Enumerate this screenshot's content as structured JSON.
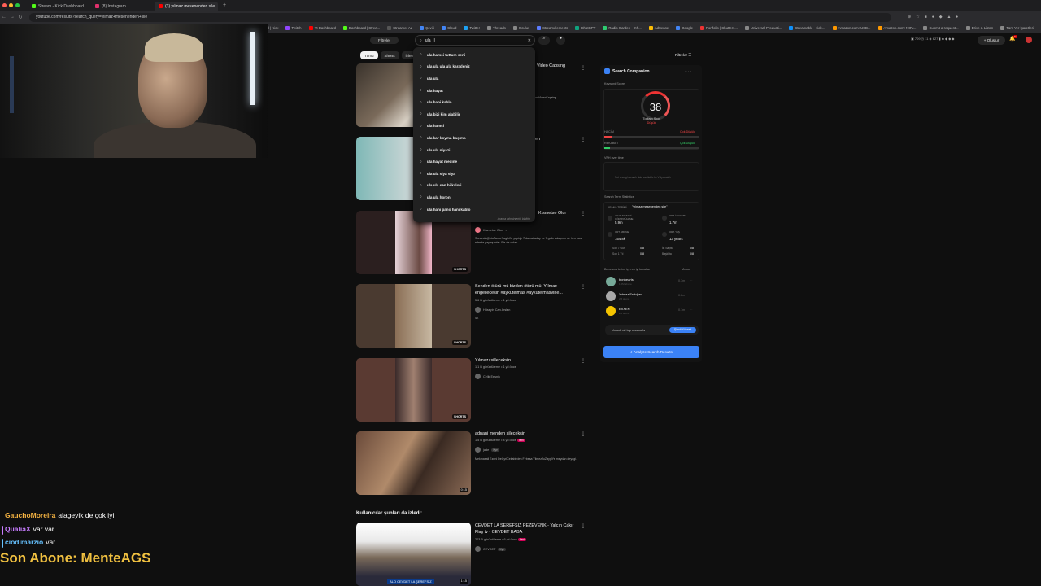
{
  "browser": {
    "tabs": [
      {
        "label": "Stream - Kick Dashboard",
        "color": "#53fc18",
        "active": false
      },
      {
        "label": "(8) Instagram",
        "color": "#e1306c",
        "active": false
      },
      {
        "label": "(3) yılmaz mesenenden sile",
        "color": "#ff0000",
        "active": true
      }
    ],
    "new_tab": "+",
    "url": "youtube.com/results?search_query=yilmaz+mesenenden+sile",
    "bookmarks": [
      {
        "label": "sterer | Kick",
        "color": "#53fc18"
      },
      {
        "label": "Dashboard | Kick",
        "color": "#53fc18"
      },
      {
        "label": "Twitch",
        "color": "#9146ff"
      },
      {
        "label": "Yt Dashboard",
        "color": "#ff0000"
      },
      {
        "label": "Dashboard | Strea...",
        "color": "#53fc18"
      },
      {
        "label": "Streamer Ad",
        "color": "#555"
      },
      {
        "label": "Çeviri",
        "color": "#4285f4"
      },
      {
        "label": "Cloud",
        "color": "#4285f4"
      },
      {
        "label": "Twitter",
        "color": "#1da1f2"
      },
      {
        "label": "Threads",
        "color": "#888"
      },
      {
        "label": "Oculus",
        "color": "#888"
      },
      {
        "label": "Streamelements",
        "color": "#5b7cff"
      },
      {
        "label": "ChatGPT",
        "color": "#10a37f"
      },
      {
        "label": "Radio Garden – Kh...",
        "color": "#2ecc71"
      },
      {
        "label": "AdSense",
        "color": "#fbbc05"
      },
      {
        "label": "Google",
        "color": "#4285f4"
      },
      {
        "label": "Portfolio | Shutters...",
        "color": "#e33"
      },
      {
        "label": "Universal Producti...",
        "color": "#888"
      },
      {
        "label": "Streamable - vide...",
        "color": "#0f90fa"
      },
      {
        "label": "Amazon.com: USB...",
        "color": "#ff9900"
      },
      {
        "label": "Amazon.com: NOV...",
        "color": "#ff9900"
      },
      {
        "label": "Submit a request...",
        "color": "#888"
      },
      {
        "label": "Drive & Listen",
        "color": "#888"
      },
      {
        "label": "Tüm Yer İşaretleri",
        "color": "#888"
      }
    ]
  },
  "youtube": {
    "filters_chip": "Filtreler",
    "search_value": "ula",
    "create_label": "Oluştur",
    "notif_count": "9+",
    "chips": [
      "Tümü",
      "Shorts",
      "İzlenm"
    ],
    "filters_right": "Filtreler",
    "suggestions": [
      "ula hamsi tuttum seni",
      "ula ula ula ula karadeniz",
      "ula ula",
      "ula hayat",
      "ula hani kablo",
      "ula bizi kim alabilir",
      "ula hamsi",
      "ula kar koyma başıma",
      "ula ula niyazi",
      "ula hayat medine",
      "ula ula siya siya",
      "ula ula sen bi kalori",
      "ula ula horon",
      "ula hani pano hani kablo"
    ],
    "report_label": "Arama tahminlerini bildirin",
    "results": [
      {
        "title": "Video Capsing",
        "meta": "",
        "channel": "",
        "desc": "om/VideoCapsing",
        "badge": ""
      },
      {
        "title": "en",
        "meta": "",
        "channel": "",
        "desc": "",
        "badge": ""
      },
      {
        "title": "Kısmetse Olur",
        "meta": "",
        "channel": "Kısmetse Olur",
        "desc": "Sonunda@ptuTanla Nagihi'in yaptığı 7 damat aday ve 7 gelin adayının ve hen para ederde paylaşanlar. Biz de onları...",
        "badge": "SHORTS"
      },
      {
        "title": "Senden ötürü mü bizden ötürü mü, Yılmaz engellecesin #aykutelmas #aykutelmasvine...",
        "meta": "5,6 B görüntüleme • 1 yıl önce",
        "channel": "Hüseyin Can Arslan",
        "desc": "4K",
        "badge": "SHORTS"
      },
      {
        "title": "Yılmazı silleceksin",
        "meta": "1,1 B görüntüleme • 1 yıl önce",
        "channel": "Celik Eeşnik",
        "desc": "",
        "badge": "SHORTS"
      },
      {
        "title": "adnani menden sileceksin",
        "meta": "1,5 B görüntüleme • 4 yıl önce",
        "channel": "jade",
        "desc": "Mekmasali Ezeni DeCyriCekabirden Firbesa YilmezJuZaygiYe meydan deyagi.",
        "badge": "0:15"
      }
    ],
    "also_watched": "Kullanıcılar şunları da izledi:",
    "related": {
      "title": "CEVDET LA ŞEREFSİZ PEZEVENK - Yalçın Çakır Flaş tv - CEVDET BABA",
      "meta": "203 B görüntüleme • 6 yıl önce",
      "channel": "CEVDET",
      "duration": "1:15",
      "banner": "ALO CEVDET LA ŞEREFSİZ"
    }
  },
  "companion": {
    "title": "Search Companion",
    "keyword_score_label": "Keyword Score",
    "score": "38",
    "score_caption": "Toplam Skor",
    "score_grade": "Düşük",
    "volume_label": "HACİM",
    "volume_value": "Çok Düşük",
    "competition_label": "REKABET",
    "competition_value": "Çok Düşük",
    "vph_label": "VPH over time",
    "vph_empty": "Not enough search data available by Vidyowatch",
    "stats_title": "Search Term Statistics",
    "search_term_label": "ARAMA TERİMİ",
    "search_term": "\"yılmaz mesenenden sile\"",
    "stats": [
      {
        "label": "AYLIK TAHMİNİ GÖRÜNTÜLEME",
        "value": "5.9m"
      },
      {
        "label": "ORT. İZLENME",
        "value": "1.7m"
      },
      {
        "label": "ORT. ABONE",
        "value": "154.8k"
      },
      {
        "label": "ORT. YAŞ",
        "value": "13 years"
      }
    ],
    "mini_stats": [
      {
        "label": "Son 7 Gün",
        "value": "0/8"
      },
      {
        "label": "İlk Sayfa",
        "value": "0/8"
      },
      {
        "label": "Son 1 Yıl",
        "value": "0/8"
      },
      {
        "label": "Başlıkta",
        "value": "0/8"
      }
    ],
    "channels_title": "Bu arama terimi için en iyi kanallar",
    "channels_view": "Views",
    "channels": [
      {
        "name": "bonhearts",
        "sub": "1,0M abone",
        "views": "0.3m",
        "color": "#7a9"
      },
      {
        "name": "Yılmaz Erdoğan",
        "sub": "2M abone",
        "views": "0.2m",
        "color": "#aaa"
      },
      {
        "name": "EXXEN",
        "sub": "2M abone",
        "views": "0.1m",
        "color": "#f5c400"
      }
    ],
    "unlock_label": "Unlock all top channels",
    "upgrade_label": "Şimdi Yükselt",
    "analyze_label": "Analyze Search Results"
  },
  "chat": [
    {
      "user": "GauchoMoreira",
      "color": "#f5b342",
      "msg": "alageyik de çok iyi"
    },
    {
      "user": "QualiaX",
      "color": "#c77dff",
      "msg": "var var"
    },
    {
      "user": "ciodimarzio",
      "color": "#66c2ff",
      "msg": "var"
    }
  ],
  "last_sub": "Son Abone: MenteAGS"
}
